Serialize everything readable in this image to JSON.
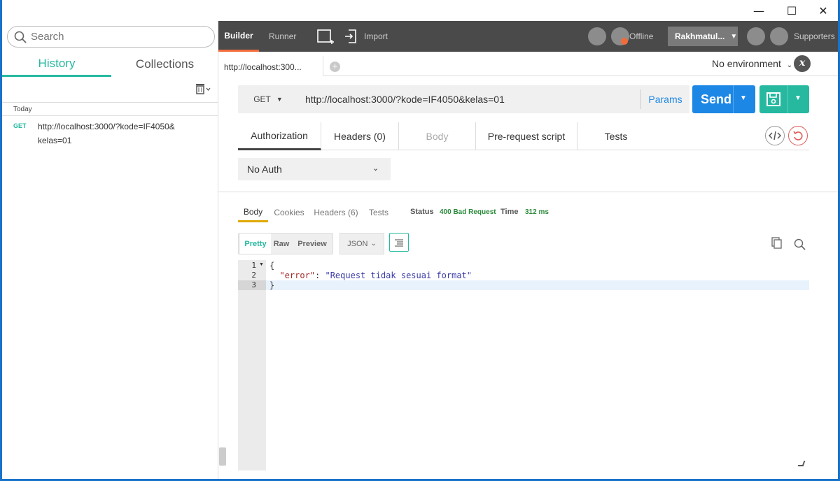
{
  "window": {
    "minimize": "—",
    "maximize": "☐",
    "close": "✕"
  },
  "sidebar": {
    "search_placeholder": "Search",
    "tabs": [
      {
        "label": "History"
      },
      {
        "label": "Collections"
      }
    ],
    "day": "Today",
    "history": [
      {
        "method": "GET",
        "url": "http://localhost:3000/?kode=IF4050&kelas=01"
      }
    ]
  },
  "topbar": {
    "builder": "Builder",
    "runner": "Runner",
    "import": "Import",
    "offline": "Offline",
    "user": "Rakhmatul...",
    "supporters": "Supporters"
  },
  "request_tab": {
    "label": "http://localhost:300...",
    "add": "+"
  },
  "environment": {
    "selected": "No environment",
    "icon": "x"
  },
  "request": {
    "method": "GET",
    "url": "http://localhost:3000/?kode=IF4050&kelas=01",
    "params": "Params",
    "send": "Send"
  },
  "subtabs": [
    {
      "label": "Authorization"
    },
    {
      "label": "Headers (0)"
    },
    {
      "label": "Body"
    },
    {
      "label": "Pre-request script"
    },
    {
      "label": "Tests"
    }
  ],
  "auth": {
    "type": "No Auth"
  },
  "response": {
    "tabs": [
      {
        "label": "Body"
      },
      {
        "label": "Cookies"
      },
      {
        "label": "Headers (6)"
      },
      {
        "label": "Tests"
      }
    ],
    "status_label": "Status",
    "status_value": "400 Bad Request",
    "time_label": "Time",
    "time_value": "312 ms",
    "formats": [
      {
        "label": "Pretty"
      },
      {
        "label": "Raw"
      },
      {
        "label": "Preview"
      }
    ],
    "language": "JSON",
    "lines": [
      {
        "num": "1",
        "text": "{"
      },
      {
        "num": "2",
        "key": "\"error\"",
        "sep": ": ",
        "value": "\"Request tidak sesuai format\""
      },
      {
        "num": "3",
        "text": "}"
      }
    ]
  },
  "colors": {
    "accent_teal": "#26b9a0",
    "send_blue": "#1d87e5",
    "builder_orange": "#f26b3a",
    "status_green": "#2a8a3a"
  }
}
